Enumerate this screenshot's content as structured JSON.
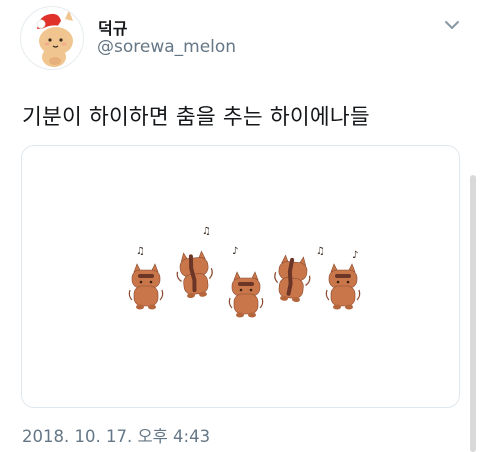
{
  "tweet": {
    "user": {
      "display_name": "덕규",
      "handle": "@sorewa_melon",
      "avatar": "cartoon-avatar-with-santa-hat"
    },
    "menu_icon": "chevron-down-icon",
    "text": "기분이 하이하면 춤을 추는 하이에나들",
    "media": {
      "description_icon": "dancing-hyenas-illustration",
      "figures": 5,
      "notes": "♪ music notes"
    },
    "timestamp": "2018. 10. 17. 오후 4:43"
  },
  "colors": {
    "text_primary": "#14171a",
    "text_secondary": "#657786",
    "border": "#e1e8ed",
    "hyena_body": "#c9774a",
    "hyena_stripe": "#6b3528"
  }
}
